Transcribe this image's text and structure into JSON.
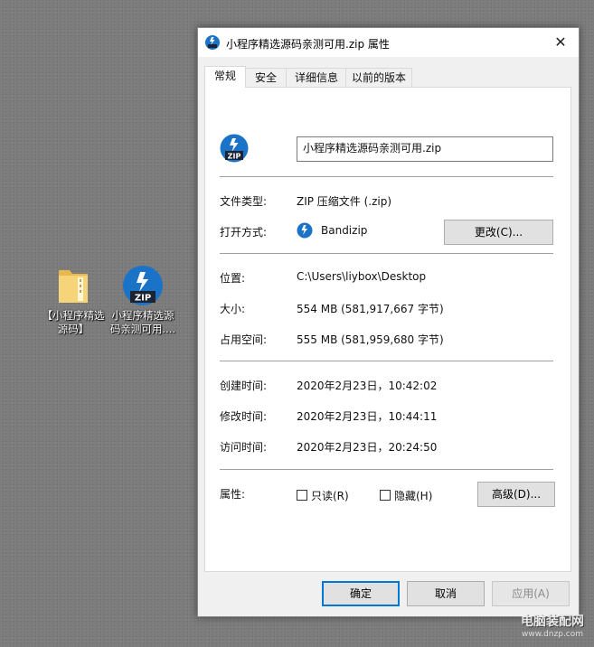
{
  "desktop": {
    "icons": [
      {
        "label": "【小程序精选源码】",
        "kind": "folder"
      },
      {
        "label": "小程序精选源码亲测可用....",
        "kind": "zip"
      }
    ]
  },
  "dialog": {
    "title": "小程序精选源码亲测可用.zip 属性",
    "close_glyph": "✕",
    "tabs": [
      "常规",
      "安全",
      "详细信息",
      "以前的版本"
    ],
    "filename": "小程序精选源码亲测可用.zip",
    "file_type_label": "文件类型:",
    "file_type_value": "ZIP 压缩文件 (.zip)",
    "opens_with_label": "打开方式:",
    "opens_with_value": "Bandizip",
    "change_button": "更改(C)...",
    "location_label": "位置:",
    "location_value": "C:\\Users\\liybox\\Desktop",
    "size_label": "大小:",
    "size_value": "554 MB (581,917,667 字节)",
    "size_on_disk_label": "占用空间:",
    "size_on_disk_value": "555 MB (581,959,680 字节)",
    "created_label": "创建时间:",
    "created_value": "2020年2月23日，10:42:02",
    "modified_label": "修改时间:",
    "modified_value": "2020年2月23日，10:44:11",
    "accessed_label": "访问时间:",
    "accessed_value": "2020年2月23日，20:24:50",
    "attributes_label": "属性:",
    "readonly_label": "只读(R)",
    "hidden_label": "隐藏(H)",
    "advanced_button": "高级(D)...",
    "ok_button": "确定",
    "cancel_button": "取消",
    "apply_button": "应用(A)"
  },
  "watermark": {
    "title": "电脑装配网",
    "url": "www.dnzp.com"
  },
  "colors": {
    "accent": "#0078d7",
    "zip_blue": "#1a73c7"
  }
}
